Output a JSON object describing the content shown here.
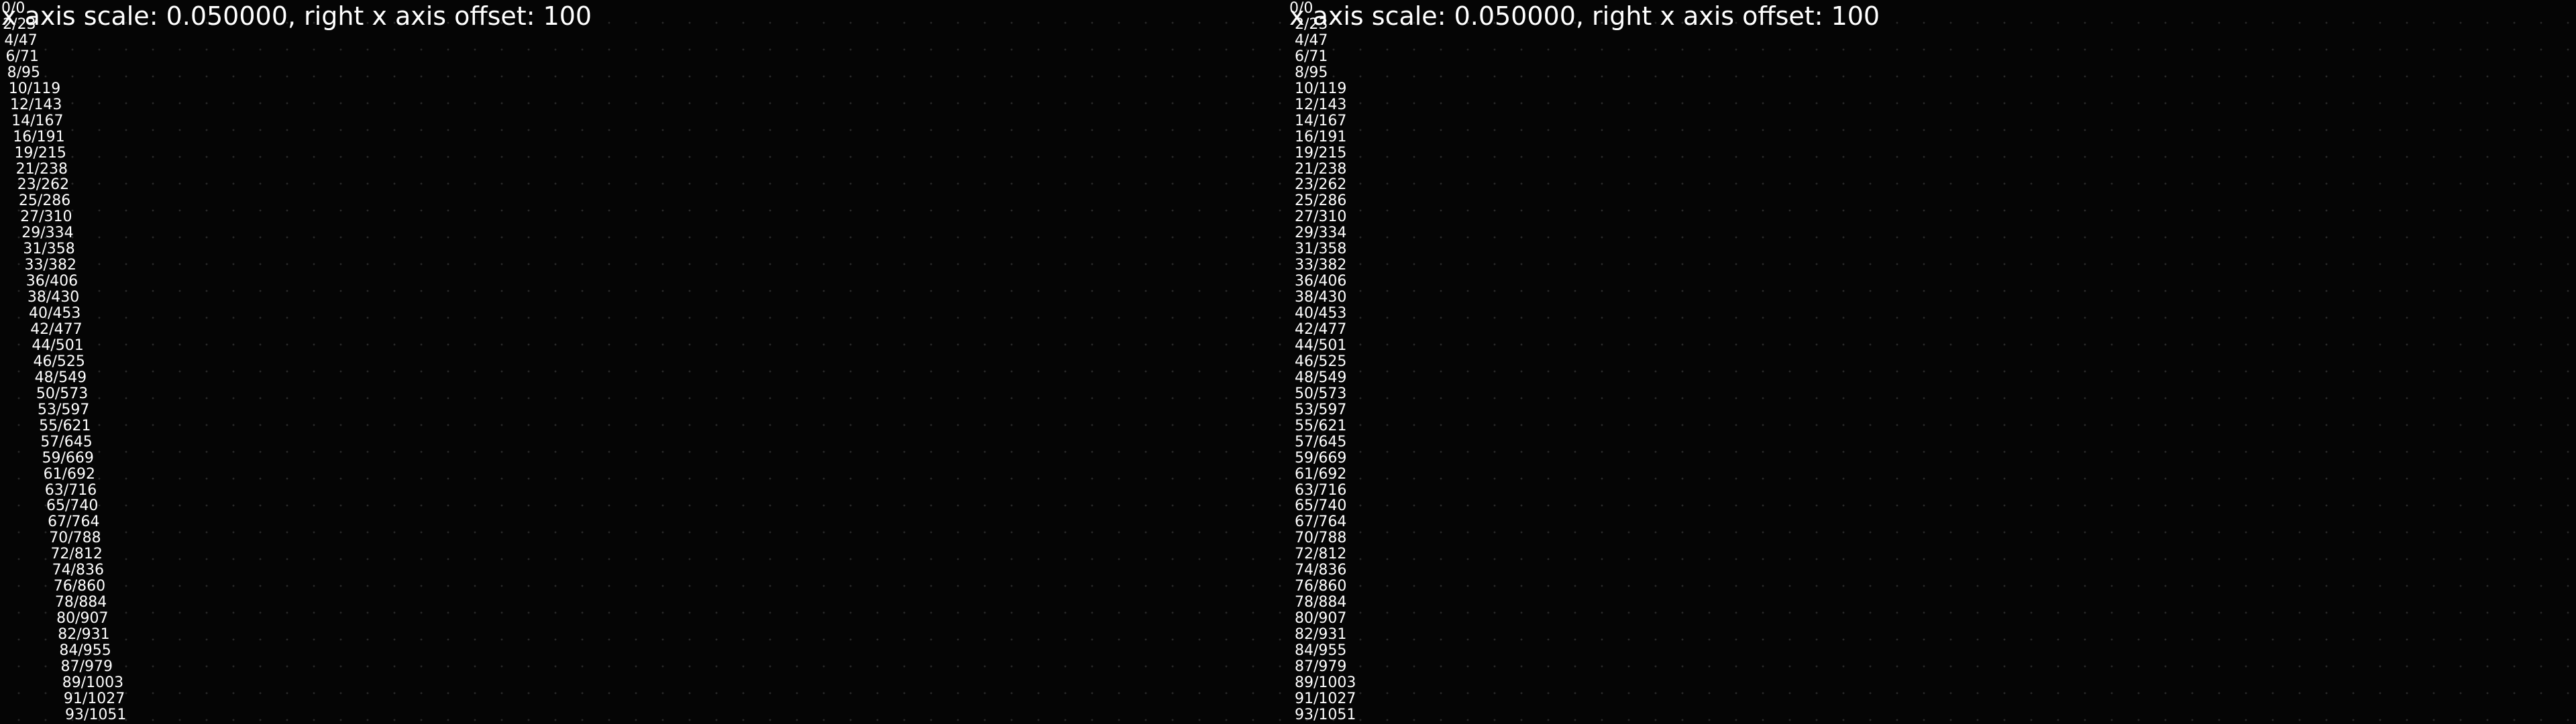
{
  "panes": [
    {
      "id": "left",
      "header": "x axis scale: 0.050000, right x axis offset: 100"
    },
    {
      "id": "right",
      "header": "x axis scale: 0.050000, right x axis offset: 100"
    }
  ],
  "tick_labels": [
    "0/0",
    "2/23",
    "4/47",
    "6/71",
    "8/95",
    "10/119",
    "12/143",
    "14/167",
    "16/191",
    "19/215",
    "21/238",
    "23/262",
    "25/286",
    "27/310",
    "29/334",
    "31/358",
    "33/382",
    "36/406",
    "38/430",
    "40/453",
    "42/477",
    "44/501",
    "46/525",
    "48/549",
    "50/573",
    "53/597",
    "55/621",
    "57/645",
    "59/669",
    "61/692",
    "63/716",
    "65/740",
    "67/764",
    "70/788",
    "72/812",
    "74/836",
    "76/860",
    "78/884",
    "80/907",
    "82/931",
    "84/955",
    "87/979",
    "89/1003",
    "91/1027",
    "93/1051"
  ],
  "colors": {
    "background": "#050505",
    "grid_dot": "#2a2a2a",
    "text": "#ffffff"
  }
}
